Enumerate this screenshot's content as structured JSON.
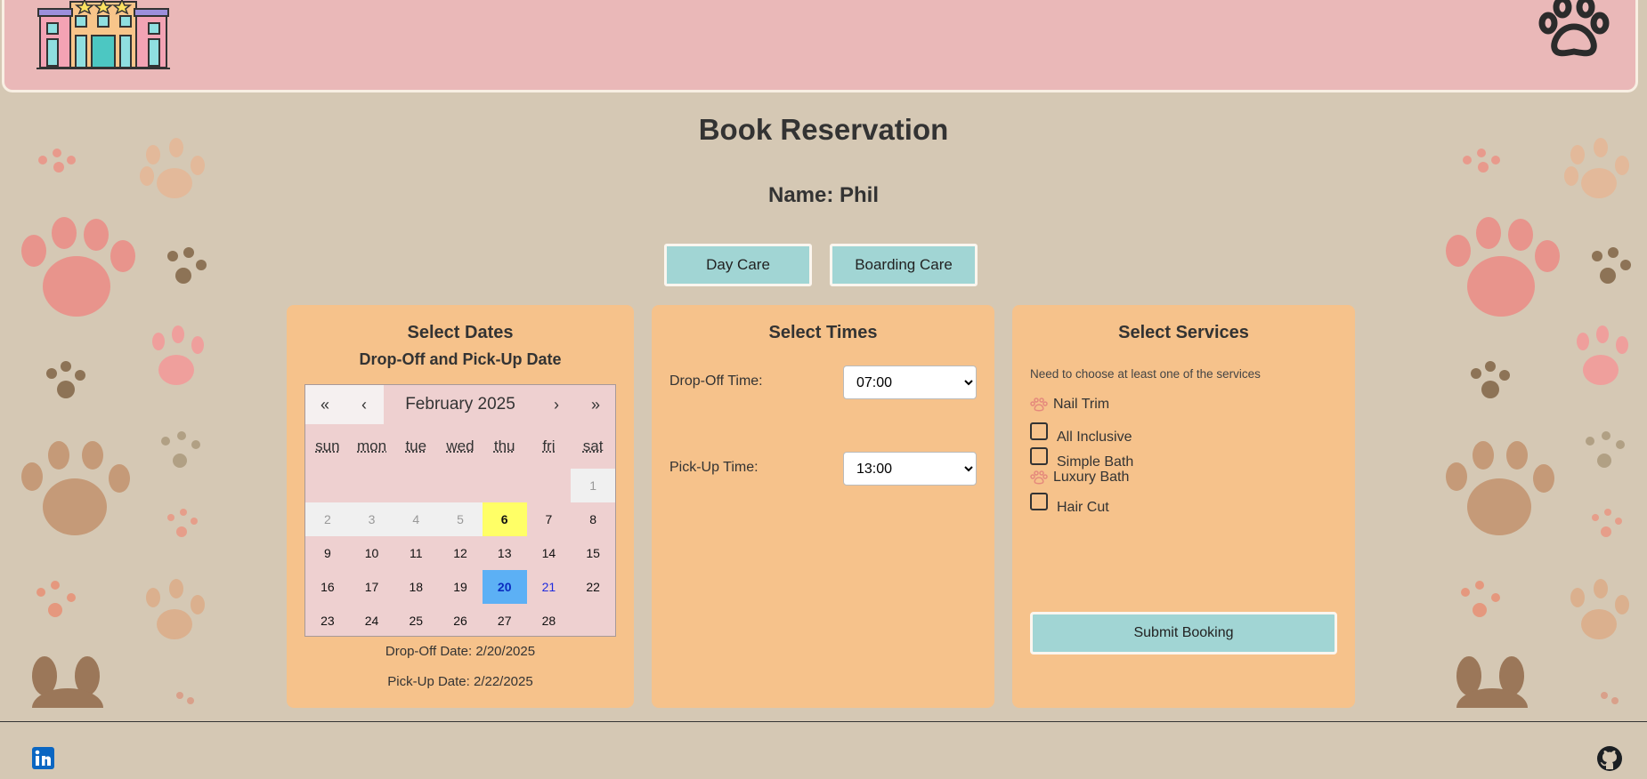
{
  "page": {
    "title": "Book Reservation",
    "name_line": "Name: Phil"
  },
  "care_types": [
    {
      "label": "Day Care"
    },
    {
      "label": "Boarding Care"
    }
  ],
  "dates_panel": {
    "heading": "Select Dates",
    "subheading": "Drop-Off and Pick-Up Date",
    "calendar": {
      "prev_year": "«",
      "prev_month": "‹",
      "month_label": "February 2025",
      "next_month": "›",
      "next_year": "»",
      "weekdays": [
        "sun",
        "mon",
        "tue",
        "wed",
        "thu",
        "fri",
        "sat"
      ]
    },
    "dropoff_date": "Drop-Off Date: 2/20/2025",
    "pickup_date": "Pick-Up Date: 2/22/2025"
  },
  "times_panel": {
    "heading": "Select Times",
    "dropoff_label": "Drop-Off Time:",
    "dropoff_value": "07:00",
    "pickup_label": "Pick-Up Time:",
    "pickup_value": "13:00"
  },
  "services_panel": {
    "heading": "Select Services",
    "note": "Need to choose at least one of the services",
    "services": [
      {
        "label": "Nail Trim",
        "selected": true
      },
      {
        "label": "All Inclusive",
        "selected": false
      },
      {
        "label": "Simple Bath",
        "selected": false
      },
      {
        "label": "Luxury Bath",
        "selected": true
      },
      {
        "label": "Hair Cut",
        "selected": false
      }
    ],
    "submit_label": "Submit Booking"
  },
  "icons": {
    "hotel": "hotel-logo-icon",
    "paw": "paw-icon",
    "linkedin": "linkedin-icon",
    "github": "github-icon"
  },
  "colors": {
    "background": "#d5c8b4",
    "header": "#eab8b8",
    "panel": "#f6c28b",
    "button": "#a1d5d4",
    "calendar": "#eed0d0",
    "today": "#ffff66",
    "selected": "#5cb0f5"
  }
}
